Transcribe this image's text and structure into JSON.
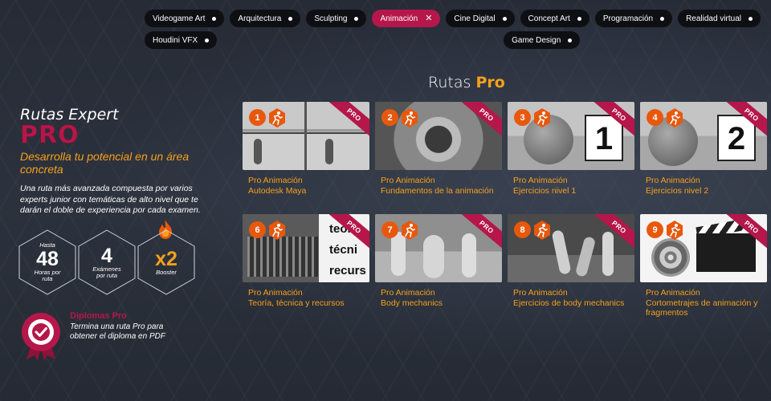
{
  "filters": [
    {
      "label": "Videogame Art",
      "active": false
    },
    {
      "label": "Arquitectura",
      "active": false
    },
    {
      "label": "Sculpting",
      "active": false
    },
    {
      "label": "Animación",
      "active": true
    },
    {
      "label": "Cine Digital",
      "active": false
    },
    {
      "label": "Concept Art",
      "active": false
    },
    {
      "label": "Programación",
      "active": false
    },
    {
      "label": "Realidad virtual",
      "active": false
    },
    {
      "label": "Houdini VFX",
      "active": false
    },
    {
      "label": "Game Design",
      "active": false
    }
  ],
  "section": {
    "title": "Rutas",
    "title_highlight": "Pro"
  },
  "left": {
    "title": "Rutas Expert",
    "brand": "PRO",
    "subtitle": "Desarrolla tu potencial en un área concreta",
    "description": "Una ruta más avanzada compuesta por varios experts junior con temáticas de alto nivel que te darán el doble de experiencia por cada examen.",
    "stats": [
      {
        "top": "Hasta",
        "value": "48",
        "bottom": "Horas por ruta"
      },
      {
        "top": "",
        "value": "4",
        "bottom": "Exámenes por ruta"
      },
      {
        "top": "",
        "value": "x2",
        "bottom": "Booster"
      }
    ],
    "diploma": {
      "title": "Diplomas Pro",
      "text": "Termina una ruta Pro para obtener el diploma en PDF"
    }
  },
  "ribbon_label": "PRO",
  "cards": [
    {
      "number": "1",
      "line1": "Pro Animación",
      "line2": "Autodesk Maya"
    },
    {
      "number": "2",
      "line1": "Pro Animación",
      "line2": "Fundamentos de la animación"
    },
    {
      "number": "3",
      "line1": "Pro Animación",
      "line2": "Ejercicios nivel 1",
      "thumb_text": "1"
    },
    {
      "number": "4",
      "line1": "Pro Animación",
      "line2": "Ejercicios nivel 2",
      "thumb_text": "2"
    },
    {
      "number": "6",
      "line1": "Pro Animación",
      "line2": "Teoría, técnica y recursos",
      "thumb_text": "teori técni recurs"
    },
    {
      "number": "7",
      "line1": "Pro Animación",
      "line2": "Body mechanics"
    },
    {
      "number": "8",
      "line1": "Pro Animación",
      "line2": "Ejercicios de body mechanics"
    },
    {
      "number": "9",
      "line1": "Pro Animación",
      "line2": "Cortometrajes de animación y fragmentos"
    }
  ],
  "colors": {
    "accent": "#b5174a",
    "orange": "#f5a01c",
    "badge": "#e8580c"
  }
}
